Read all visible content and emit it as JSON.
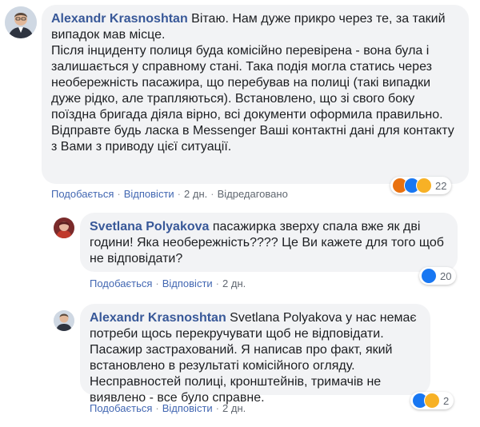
{
  "comments": [
    {
      "author": "Alexandr Krasnoshtan",
      "text": " Вітаю. Нам дуже прикро через те, за такий випадок мав місце.\nПісля інциденту полиця буда комісійно перевірена - вона була і залишається у справному стані. Така подія могла статись через необережність пасажира, що перебував на полиці (такі випадки дуже рідко, але трапляються). Встановлено, що зі свого боку поїздна бригада діяла вірно, всі документи оформила правильно.\nВідправте будь ласка в Messenger Ваші контактні дані для контакту з Вами з приводу цієї ситуації.",
      "like_label": "Подобається",
      "reply_label": "Відповісти",
      "time": "2 дн.",
      "edited_label": "Відредаговано",
      "reaction_icons": [
        "angry-icon",
        "like-icon",
        "wow-icon"
      ],
      "reaction_count": "22"
    },
    {
      "author": "Svetlana Polyakova",
      "text": " пасажирка зверху спала вже як дві години! Яка необережність???? Це Ви кажете для того щоб не відповідати?",
      "like_label": "Подобається",
      "reply_label": "Відповісти",
      "time": "2 дн.",
      "reaction_icons": [
        "like-icon"
      ],
      "reaction_count": "20"
    },
    {
      "author": "Alexandr Krasnoshtan",
      "text": " Svetlana Polyakova у нас немає потреби щось перекручувати щоб не відповідати. Пасажир застрахований. Я написав про факт, який встановлено в результаті комісійного огляду. Несправностей полиці, кронштейнів, тримачів не виявлено - все було справне.",
      "like_label": "Подобається",
      "reply_label": "Відповісти",
      "time": "2 дн.",
      "reaction_icons": [
        "like-icon",
        "wow-icon"
      ],
      "reaction_count": "2"
    }
  ],
  "separator": "·",
  "colors": {
    "bubble_bg": "#f2f3f5",
    "author": "#385898",
    "link": "#4267b2",
    "like": "#1877f2",
    "angry": "#e9710f",
    "wow": "#f7b125"
  }
}
